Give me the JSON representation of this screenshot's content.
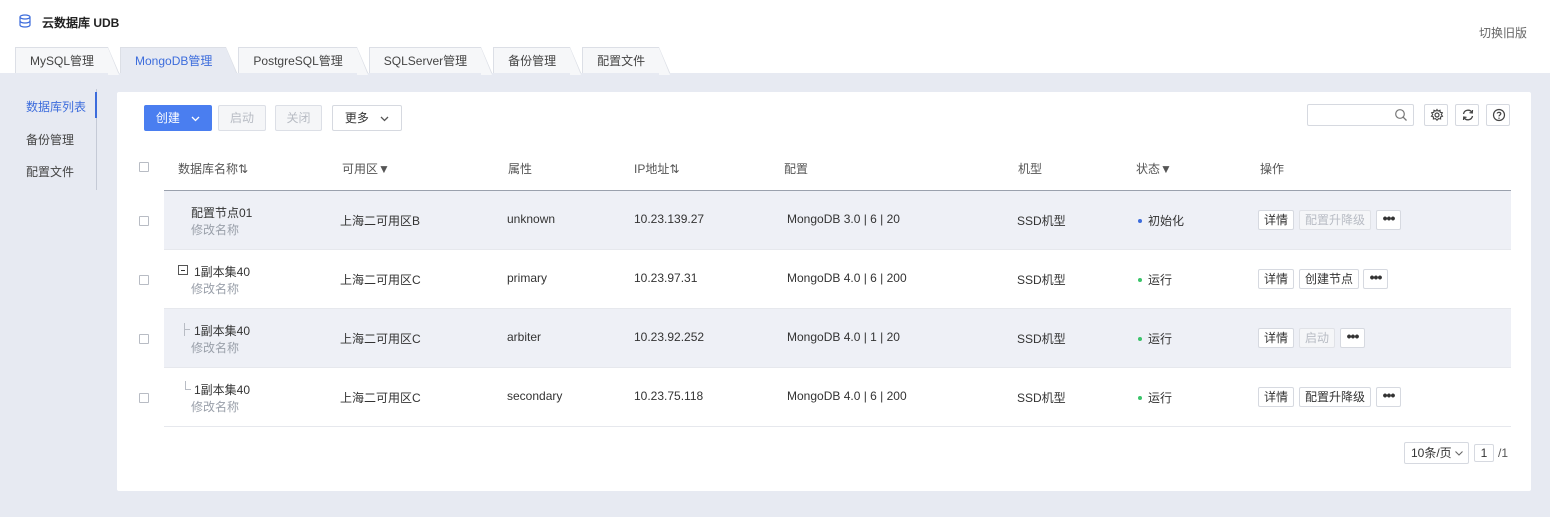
{
  "app": {
    "title": "云数据库 UDB",
    "switch_old": "切换旧版"
  },
  "tabs": [
    "MySQL管理",
    "MongoDB管理",
    "PostgreSQL管理",
    "SQLServer管理",
    "备份管理",
    "配置文件"
  ],
  "active_tab": 1,
  "side_menu": [
    "数据库列表",
    "备份管理",
    "配置文件"
  ],
  "toolbar": {
    "create": "创建",
    "start": "启动",
    "close": "关闭",
    "more": "更多",
    "search_placeholder": ""
  },
  "table": {
    "headers": {
      "name": "数据库名称⇅",
      "zone": "可用区▼",
      "attr": "属性",
      "ip": "IP地址⇅",
      "config": "配置",
      "type": "机型",
      "status": "状态▼",
      "ops": "操作"
    },
    "rows": [
      {
        "name": "配置节点01",
        "rename": "修改名称",
        "zone": "上海二可用区B",
        "attr": "unknown",
        "ip": "10.23.139.27",
        "config": "MongoDB 3.0 | 6 | 20",
        "type": "SSD机型",
        "status": "初始化",
        "status_color": "#3c6cdc",
        "op1": "详情",
        "op2": "配置升降级",
        "op2_disabled": true
      },
      {
        "name": "1副本集40",
        "rename": "修改名称",
        "zone": "上海二可用区C",
        "attr": "primary",
        "ip": "10.23.97.31",
        "config": "MongoDB 4.0 | 6 | 200",
        "type": "SSD机型",
        "status": "运行",
        "status_color": "#3bc46a",
        "op1": "详情",
        "op2": "创建节点",
        "op2_disabled": false
      },
      {
        "name": "1副本集40",
        "rename": "修改名称",
        "zone": "上海二可用区C",
        "attr": "arbiter",
        "ip": "10.23.92.252",
        "config": "MongoDB 4.0 | 1 | 20",
        "type": "SSD机型",
        "status": "运行",
        "status_color": "#3bc46a",
        "op1": "详情",
        "op2": "启动",
        "op2_disabled": true
      },
      {
        "name": "1副本集40",
        "rename": "修改名称",
        "zone": "上海二可用区C",
        "attr": "secondary",
        "ip": "10.23.75.118",
        "config": "MongoDB 4.0 | 6 | 200",
        "type": "SSD机型",
        "status": "运行",
        "status_color": "#3bc46a",
        "op1": "详情",
        "op2": "配置升降级",
        "op2_disabled": false
      }
    ]
  },
  "pagination": {
    "page_size": "10条/页",
    "current": "1",
    "total": "/1"
  }
}
